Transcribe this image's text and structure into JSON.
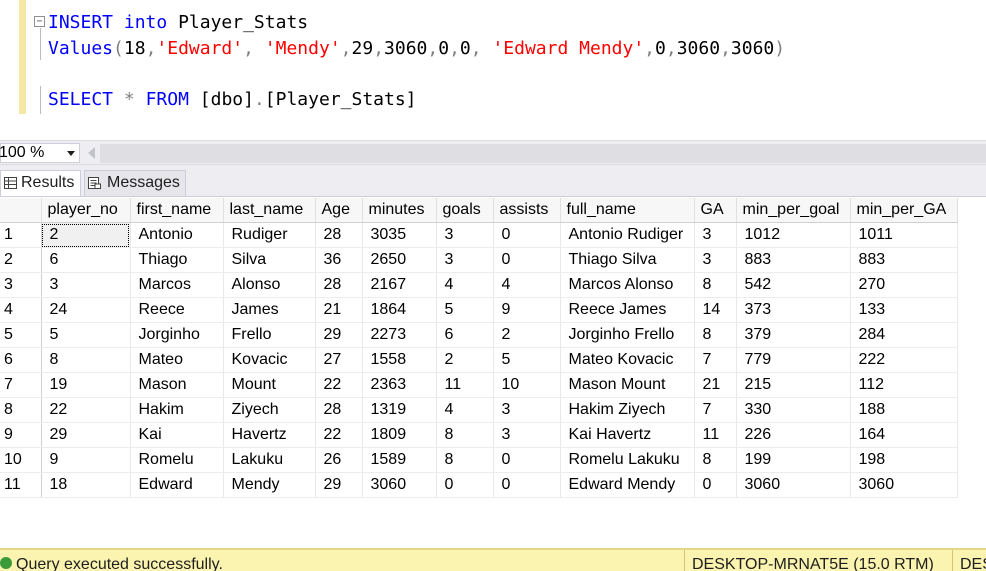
{
  "editor": {
    "line1": {
      "insert": "INSERT",
      "into": "into",
      "table": "Player_Stats"
    },
    "line2": {
      "values": "Values",
      "open": "(",
      "v1": "18",
      "c1": ",",
      "v2": "'Edward'",
      "c2": ", ",
      "v3": "'Mendy'",
      "c3": ",",
      "v4": "29",
      "c4": ",",
      "v5": "3060",
      "c5": ",",
      "v6": "0",
      "c6": ",",
      "v7": "0",
      "c7": ", ",
      "v8": "'Edward Mendy'",
      "c8": ",",
      "v9": "0",
      "c9": ",",
      "v10": "3060",
      "c10": ",",
      "v11": "3060",
      "close": ")"
    },
    "line3": {
      "select": "SELECT",
      "star": "*",
      "from": "FROM",
      "schema": "[dbo]",
      "dot": ".",
      "table": "[Player_Stats]"
    }
  },
  "zoom": {
    "value": "100 %"
  },
  "tabs": {
    "results": "Results",
    "messages": "Messages"
  },
  "grid": {
    "columns": [
      "player_no",
      "first_name",
      "last_name",
      "Age",
      "minutes",
      "goals",
      "assists",
      "full_name",
      "GA",
      "min_per_goal",
      "min_per_GA"
    ],
    "rows": [
      [
        "1",
        "2",
        "Antonio",
        "Rudiger",
        "28",
        "3035",
        "3",
        "0",
        "Antonio Rudiger",
        "3",
        "1012",
        "1011"
      ],
      [
        "2",
        "6",
        "Thiago",
        "Silva",
        "36",
        "2650",
        "3",
        "0",
        "Thiago Silva",
        "3",
        "883",
        "883"
      ],
      [
        "3",
        "3",
        "Marcos",
        "Alonso",
        "28",
        "2167",
        "4",
        "4",
        "Marcos Alonso",
        "8",
        "542",
        "270"
      ],
      [
        "4",
        "24",
        "Reece",
        "James",
        "21",
        "1864",
        "5",
        "9",
        "Reece James",
        "14",
        "373",
        "133"
      ],
      [
        "5",
        "5",
        "Jorginho",
        "Frello",
        "29",
        "2273",
        "6",
        "2",
        "Jorginho Frello",
        "8",
        "379",
        "284"
      ],
      [
        "6",
        "8",
        "Mateo",
        "Kovacic",
        "27",
        "1558",
        "2",
        "5",
        "Mateo Kovacic",
        "7",
        "779",
        "222"
      ],
      [
        "7",
        "19",
        "Mason",
        "Mount",
        "22",
        "2363",
        "11",
        "10",
        "Mason Mount",
        "21",
        "215",
        "112"
      ],
      [
        "8",
        "22",
        "Hakim",
        "Ziyech",
        "28",
        "1319",
        "4",
        "3",
        "Hakim Ziyech",
        "7",
        "330",
        "188"
      ],
      [
        "9",
        "29",
        "Kai",
        "Havertz",
        "22",
        "1809",
        "8",
        "3",
        "Kai Havertz",
        "11",
        "226",
        "164"
      ],
      [
        "10",
        "9",
        "Romelu",
        "Lakuku",
        "26",
        "1589",
        "8",
        "0",
        "Romelu Lakuku",
        "8",
        "199",
        "198"
      ],
      [
        "11",
        "18",
        "Edward",
        "Mendy",
        "29",
        "3060",
        "0",
        "0",
        "Edward Mendy",
        "0",
        "3060",
        "3060"
      ]
    ]
  },
  "status": {
    "message": "Query executed successfully.",
    "server": "DESKTOP-MRNAT5E (15.0 RTM)",
    "more": "DES"
  },
  "colors": {
    "keyword": "#0000ff",
    "function": "#ff00ff",
    "string": "#ff0000",
    "operator": "#808080",
    "status_bg": "#fbf3b0"
  }
}
